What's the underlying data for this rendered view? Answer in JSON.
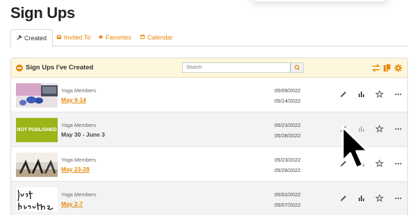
{
  "page": {
    "title": "Sign Ups"
  },
  "tabs": [
    {
      "label": "Created",
      "icon": "wrench-icon",
      "active": true
    },
    {
      "label": "Invited To",
      "icon": "inbox-icon",
      "active": false
    },
    {
      "label": "Favorites",
      "icon": "star-icon",
      "active": false
    },
    {
      "label": "Calendar",
      "icon": "calendar-icon",
      "active": false
    }
  ],
  "panel": {
    "title": "Sign Ups I've Created",
    "search_placeholder": "Search",
    "header_icons": [
      "swap-icon",
      "copy-icon",
      "gear-icon"
    ]
  },
  "rows": [
    {
      "group": "Yoga Members",
      "title": "May 9-14",
      "linked": true,
      "start": "05/09/2022",
      "end": "05/14/2022",
      "thumb": "yoga-mat-photo"
    },
    {
      "group": "Yoga Members",
      "title": "May 30 - June 3",
      "linked": false,
      "start": "05/23/2022",
      "end": "05/28/2022",
      "thumb": "not-published",
      "thumb_text": "NOT PUBLISHED"
    },
    {
      "group": "Yoga Members",
      "title": "May 23-28",
      "linked": true,
      "start": "05/23/2022",
      "end": "05/28/2022",
      "thumb": "yoga-class-photo"
    },
    {
      "group": "Yoga Members",
      "title": "May 2-7",
      "linked": true,
      "start": "05/02/2022",
      "end": "05/07/2022",
      "thumb": "just-breathe-lettering"
    }
  ],
  "row_actions": [
    "pencil-icon",
    "bar-chart-icon",
    "star-outline-icon",
    "more-icon"
  ],
  "colors": {
    "accent": "#e8870a",
    "header_bg": "#fdf7dc",
    "not_published": "#9bb51a"
  }
}
